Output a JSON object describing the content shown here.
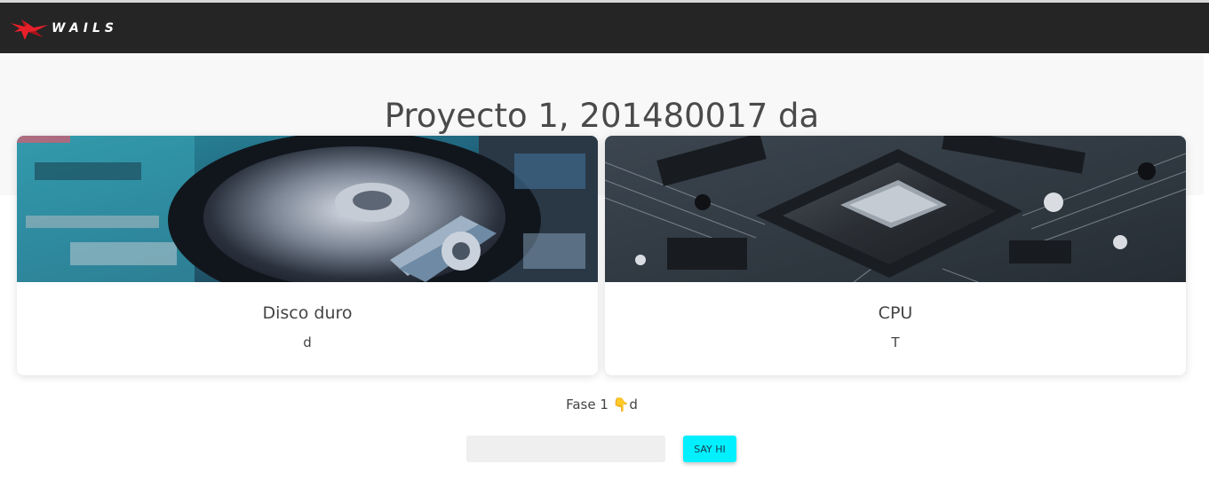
{
  "navbar": {
    "logo_text": "WAILS",
    "logo_icon": "wails-logo-icon"
  },
  "page": {
    "title": "Proyecto 1, 201480017 da"
  },
  "cards": [
    {
      "title": "Disco duro",
      "text": "d",
      "image": "hard-drive-photo"
    },
    {
      "title": "CPU",
      "text": "T",
      "image": "cpu-chip-photo"
    }
  ],
  "status": {
    "prefix": "Fase 1 ",
    "emoji": "👇",
    "value": "d"
  },
  "form": {
    "input_value": "",
    "button_label": "SAY HI"
  },
  "colors": {
    "navbar": "#252525",
    "accent_button": "#00f0ff",
    "logo_red": "#e8202a"
  }
}
